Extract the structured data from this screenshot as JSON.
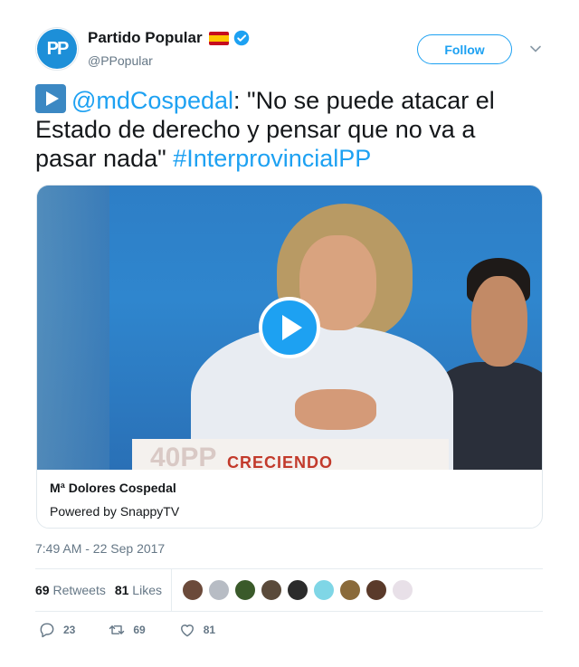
{
  "account": {
    "display_name": "Partido Popular",
    "handle": "@PPopular",
    "avatar_text": "PP",
    "verified": true,
    "flag": "spain-flag"
  },
  "follow_button": {
    "label": "Follow"
  },
  "tweet": {
    "mention": "@mdCospedal",
    "text_1": ": \"No se puede atacar el Estado de derecho y pensar que no va a pasar nada\" ",
    "hashtag": "#InterprovincialPP",
    "timestamp": "7:49 AM - 22 Sep 2017"
  },
  "card": {
    "title": "Mª Dolores Cospedal",
    "subtitle": "Powered by SnappyTV",
    "podium_text": "CRECIENDO",
    "podium_logo": "40PP"
  },
  "stats": {
    "retweets_count": "69",
    "retweets_label": "Retweets",
    "likes_count": "81",
    "likes_label": "Likes"
  },
  "actions": {
    "reply_count": "23",
    "retweet_count": "69",
    "like_count": "81"
  },
  "colors": {
    "accent": "#1da1f2",
    "text": "#14171a",
    "muted": "#657786"
  },
  "liker_avatars": [
    "#6b4a3a",
    "#b7bcc4",
    "#3a5a2a",
    "#5a4a3a",
    "#2b2b2b",
    "#7fd6e6",
    "#8a6a3a",
    "#5a3a2a",
    "#e8e0e8"
  ]
}
